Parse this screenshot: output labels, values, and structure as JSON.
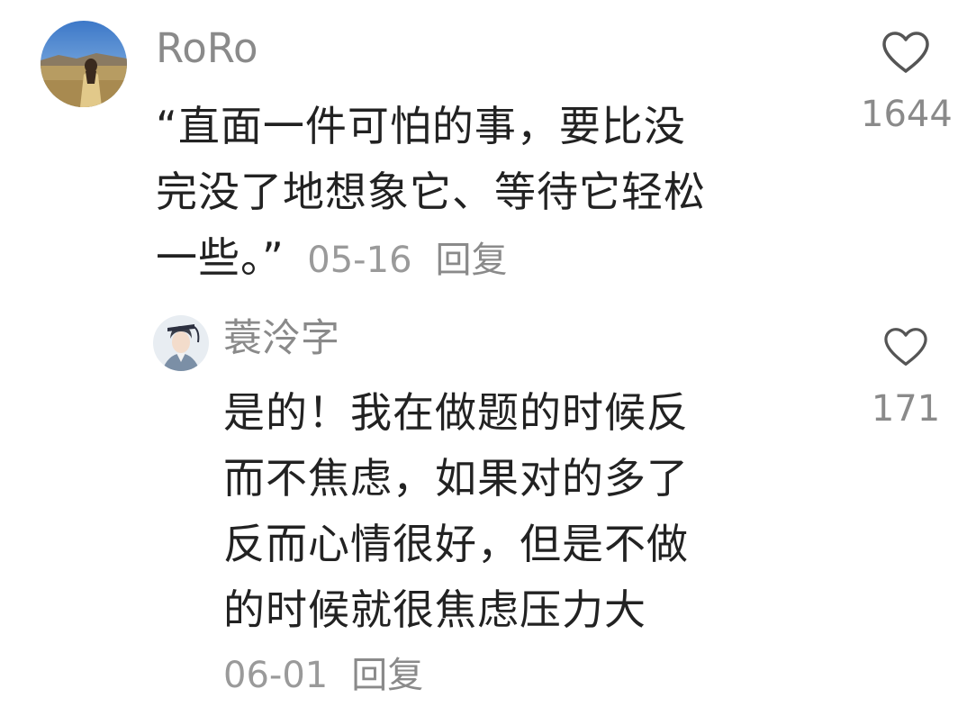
{
  "comments": [
    {
      "username": "RoRo",
      "avatar_icon": "user-avatar-landscape",
      "text_lines": [
        "“直面一件可怕的事，要比没",
        "完没了地想象它、等待它轻松",
        "一些。”"
      ],
      "date": "05-16",
      "reply_label": "回复",
      "like_icon": "heart-outline-icon",
      "like_count": "1644"
    },
    {
      "username": "蓑泠字",
      "avatar_icon": "user-avatar-illustration",
      "text_lines": [
        "是的！我在做题的时候反",
        "而不焦虑，如果对的多了",
        "反而心情很好，但是不做",
        "的时候就很焦虑压力大"
      ],
      "date": "06-01",
      "reply_label": "回复",
      "like_icon": "heart-outline-icon",
      "like_count": "171"
    }
  ],
  "colors": {
    "text": "#222222",
    "secondary": "#8a8a8a",
    "background": "#ffffff"
  }
}
